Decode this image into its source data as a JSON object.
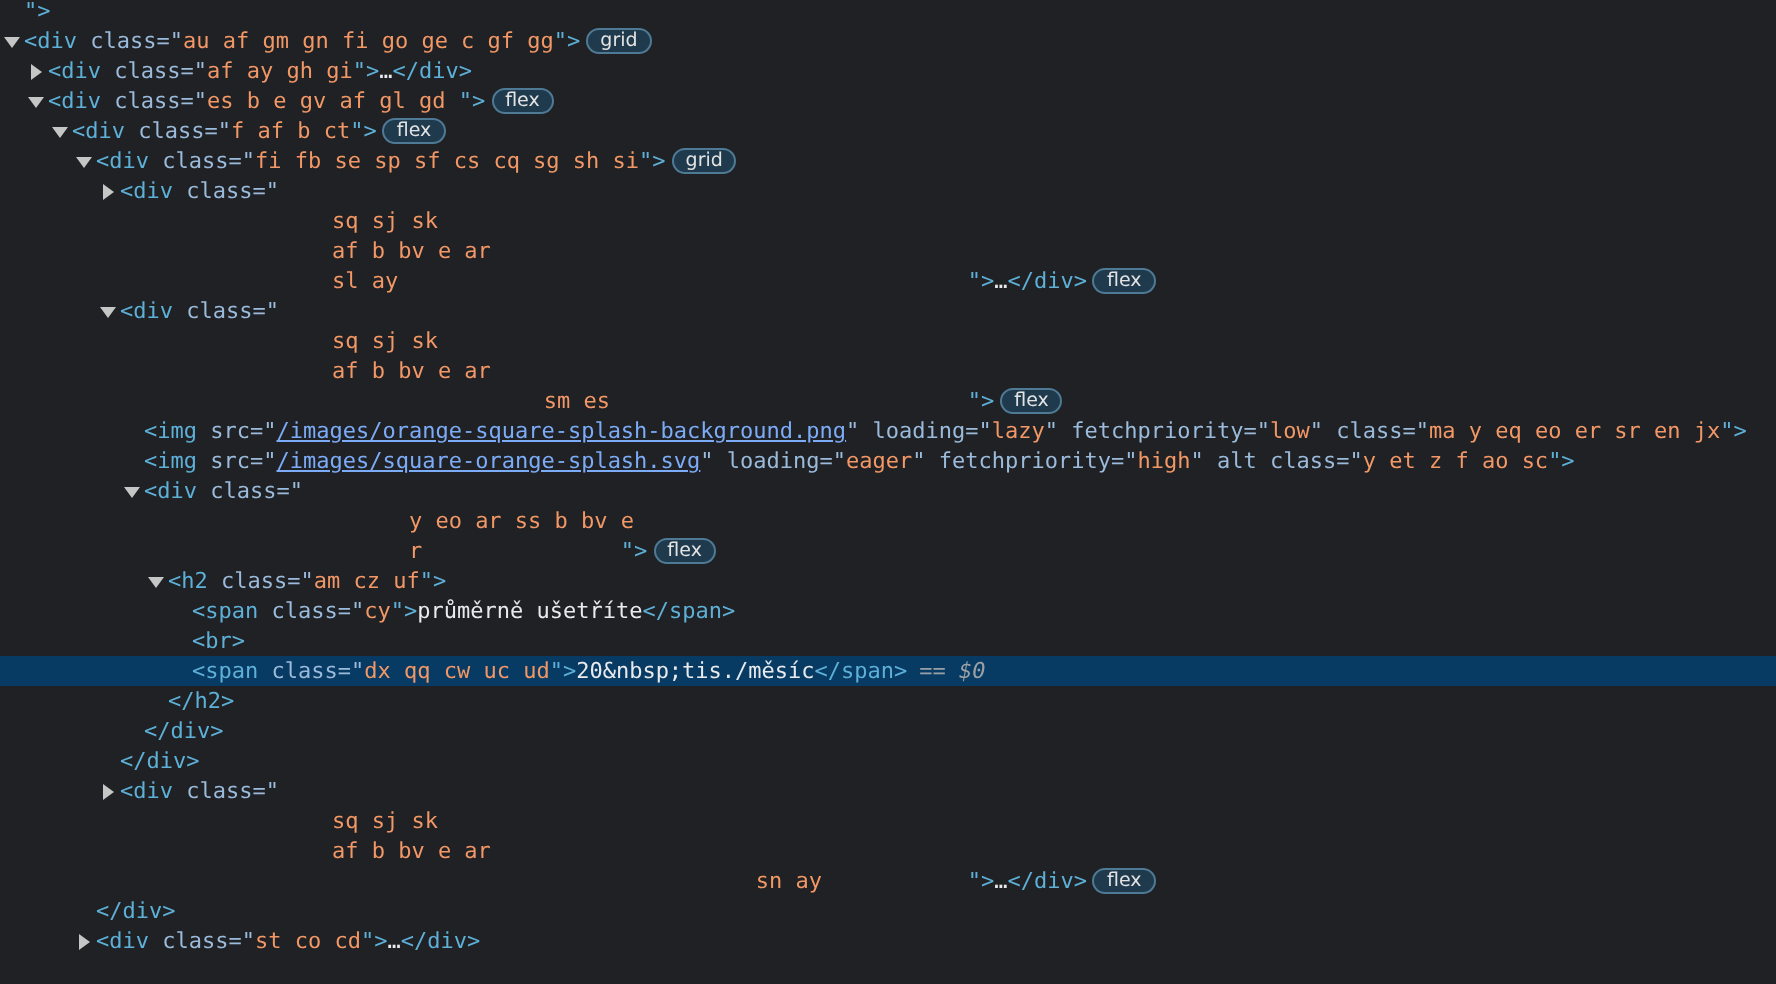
{
  "tree": [
    {
      "kind": "fragment",
      "lines": [
        [
          {
            "text": "\">",
            "kind": "tag"
          }
        ]
      ]
    },
    {
      "kind": "element",
      "expanded": true,
      "selected": false,
      "badge": "grid",
      "lines": [
        [
          {
            "text": "<div",
            "kind": "tag"
          },
          {
            "text": " class=\"",
            "kind": "attr"
          },
          {
            "text": "au af gm gn fi go ge c gf gg",
            "kind": "val"
          },
          {
            "text": "\">",
            "kind": "tag"
          }
        ]
      ],
      "children": [
        {
          "kind": "element",
          "expanded": false,
          "selected": false,
          "lines": [
            [
              {
                "text": "<div",
                "kind": "tag"
              },
              {
                "text": " class=\"",
                "kind": "attr"
              },
              {
                "text": "af ay gh gi",
                "kind": "val"
              },
              {
                "text": "\">",
                "kind": "tag"
              },
              {
                "text": "…",
                "kind": "ell"
              },
              {
                "text": "</div>",
                "kind": "tag"
              }
            ]
          ]
        },
        {
          "kind": "element",
          "expanded": true,
          "selected": false,
          "badge": "flex",
          "lines": [
            [
              {
                "text": "<div",
                "kind": "tag"
              },
              {
                "text": " class=\"",
                "kind": "attr"
              },
              {
                "text": "es b e gv af gl gd ",
                "kind": "val"
              },
              {
                "text": "\">",
                "kind": "tag"
              }
            ]
          ],
          "children": [
            {
              "kind": "element",
              "expanded": true,
              "selected": false,
              "badge": "flex",
              "lines": [
                [
                  {
                    "text": "<div",
                    "kind": "tag"
                  },
                  {
                    "text": " class=\"",
                    "kind": "attr"
                  },
                  {
                    "text": "f af b ct",
                    "kind": "val"
                  },
                  {
                    "text": "\">",
                    "kind": "tag"
                  }
                ]
              ],
              "children": [
                {
                  "kind": "element",
                  "expanded": true,
                  "selected": false,
                  "badge": "grid",
                  "lines": [
                    [
                      {
                        "text": "<div",
                        "kind": "tag"
                      },
                      {
                        "text": " class=\"",
                        "kind": "attr"
                      },
                      {
                        "text": "fi fb se sp sf cs cq sg sh si",
                        "kind": "val"
                      },
                      {
                        "text": "\">",
                        "kind": "tag"
                      }
                    ]
                  ],
                  "close": [
                    {
                      "text": "</div>",
                      "kind": "tag"
                    }
                  ],
                  "children": [
                    {
                      "kind": "element",
                      "expanded": false,
                      "selected": false,
                      "badge": "flex",
                      "lines": [
                        [
                          {
                            "text": "<div",
                            "kind": "tag"
                          },
                          {
                            "text": " class=\"",
                            "kind": "attr"
                          }
                        ],
                        [
                          {
                            "text": "                sq sj sk",
                            "kind": "val"
                          }
                        ],
                        [
                          {
                            "text": "                af b bv e ar",
                            "kind": "val"
                          }
                        ],
                        [
                          {
                            "text": "                sl ay                                           ",
                            "kind": "val"
                          },
                          {
                            "text": "\">",
                            "kind": "tag"
                          },
                          {
                            "text": "…",
                            "kind": "ell"
                          },
                          {
                            "text": "</div>",
                            "kind": "tag"
                          }
                        ]
                      ]
                    },
                    {
                      "kind": "element",
                      "expanded": true,
                      "selected": false,
                      "badge": "flex",
                      "lines": [
                        [
                          {
                            "text": "<div",
                            "kind": "tag"
                          },
                          {
                            "text": " class=\"",
                            "kind": "attr"
                          }
                        ],
                        [
                          {
                            "text": "                sq sj sk",
                            "kind": "val"
                          }
                        ],
                        [
                          {
                            "text": "                af b bv e ar",
                            "kind": "val"
                          }
                        ],
                        [
                          {
                            "text": "                                sm es                           ",
                            "kind": "val"
                          },
                          {
                            "text": "\">",
                            "kind": "tag"
                          }
                        ]
                      ],
                      "close": [
                        {
                          "text": "</div>",
                          "kind": "tag"
                        }
                      ],
                      "children": [
                        {
                          "kind": "element",
                          "selected": false,
                          "lines": [
                            [
                              {
                                "text": "<img",
                                "kind": "tag"
                              },
                              {
                                "text": " src=\"",
                                "kind": "attr"
                              },
                              {
                                "text": "/images/orange-square-splash-background.png",
                                "kind": "link"
                              },
                              {
                                "text": "\" loading=\"",
                                "kind": "attr"
                              },
                              {
                                "text": "lazy",
                                "kind": "val"
                              },
                              {
                                "text": "\" fetchpriority=\"",
                                "kind": "attr"
                              },
                              {
                                "text": "low",
                                "kind": "val"
                              },
                              {
                                "text": "\" class=\"",
                                "kind": "attr"
                              },
                              {
                                "text": "ma y eq eo er sr en jx",
                                "kind": "val"
                              },
                              {
                                "text": "\">",
                                "kind": "tag"
                              }
                            ]
                          ]
                        },
                        {
                          "kind": "element",
                          "selected": false,
                          "lines": [
                            [
                              {
                                "text": "<img",
                                "kind": "tag"
                              },
                              {
                                "text": " src=\"",
                                "kind": "attr"
                              },
                              {
                                "text": "/images/square-orange-splash.svg",
                                "kind": "link"
                              },
                              {
                                "text": "\" loading=\"",
                                "kind": "attr"
                              },
                              {
                                "text": "eager",
                                "kind": "val"
                              },
                              {
                                "text": "\" fetchpriority=\"",
                                "kind": "attr"
                              },
                              {
                                "text": "high",
                                "kind": "val"
                              },
                              {
                                "text": "\" alt class=\"",
                                "kind": "attr"
                              },
                              {
                                "text": "y et z f ao sc",
                                "kind": "val"
                              },
                              {
                                "text": "\">",
                                "kind": "tag"
                              }
                            ]
                          ]
                        },
                        {
                          "kind": "element",
                          "expanded": true,
                          "selected": false,
                          "badge": "flex",
                          "lines": [
                            [
                              {
                                "text": "<div",
                                "kind": "tag"
                              },
                              {
                                "text": " class=\"",
                                "kind": "attr"
                              }
                            ],
                            [
                              {
                                "text": "                    y eo ar ss b bv e",
                                "kind": "val"
                              }
                            ],
                            [
                              {
                                "text": "                    r               ",
                                "kind": "val"
                              },
                              {
                                "text": "\">",
                                "kind": "tag"
                              }
                            ]
                          ],
                          "close": [
                            {
                              "text": "</div>",
                              "kind": "tag"
                            }
                          ],
                          "children": [
                            {
                              "kind": "element",
                              "expanded": true,
                              "selected": false,
                              "lines": [
                                [
                                  {
                                    "text": "<h2",
                                    "kind": "tag"
                                  },
                                  {
                                    "text": " class=\"",
                                    "kind": "attr"
                                  },
                                  {
                                    "text": "am cz uf",
                                    "kind": "val"
                                  },
                                  {
                                    "text": "\">",
                                    "kind": "tag"
                                  }
                                ]
                              ],
                              "close": [
                                {
                                  "text": "</h2>",
                                  "kind": "tag"
                                }
                              ],
                              "children": [
                                {
                                  "kind": "element",
                                  "selected": false,
                                  "lines": [
                                    [
                                      {
                                        "text": "<span",
                                        "kind": "tag"
                                      },
                                      {
                                        "text": " class=\"",
                                        "kind": "attr"
                                      },
                                      {
                                        "text": "cy",
                                        "kind": "val"
                                      },
                                      {
                                        "text": "\">",
                                        "kind": "tag"
                                      },
                                      {
                                        "text": "průměrně ušetříte",
                                        "kind": "text"
                                      },
                                      {
                                        "text": "</span>",
                                        "kind": "tag"
                                      }
                                    ]
                                  ]
                                },
                                {
                                  "kind": "element",
                                  "selected": false,
                                  "lines": [
                                    [
                                      {
                                        "text": "<br>",
                                        "kind": "tag"
                                      }
                                    ]
                                  ]
                                },
                                {
                                  "kind": "element",
                                  "selected": true,
                                  "console_ref": "== $0",
                                  "lines": [
                                    [
                                      {
                                        "text": "<span",
                                        "kind": "tag"
                                      },
                                      {
                                        "text": " class=\"",
                                        "kind": "attr"
                                      },
                                      {
                                        "text": "dx qq cw uc ud",
                                        "kind": "val"
                                      },
                                      {
                                        "text": "\">",
                                        "kind": "tag"
                                      },
                                      {
                                        "text": "20&nbsp;tis./měsíc",
                                        "kind": "text"
                                      },
                                      {
                                        "text": "</span>",
                                        "kind": "tag"
                                      }
                                    ]
                                  ]
                                }
                              ]
                            }
                          ]
                        }
                      ]
                    },
                    {
                      "kind": "element",
                      "expanded": false,
                      "selected": false,
                      "badge": "flex",
                      "lines": [
                        [
                          {
                            "text": "<div",
                            "kind": "tag"
                          },
                          {
                            "text": " class=\"",
                            "kind": "attr"
                          }
                        ],
                        [
                          {
                            "text": "                sq sj sk",
                            "kind": "val"
                          }
                        ],
                        [
                          {
                            "text": "                af b bv e ar",
                            "kind": "val"
                          }
                        ],
                        [
                          {
                            "text": "                                                sn ay           ",
                            "kind": "val"
                          },
                          {
                            "text": "\">",
                            "kind": "tag"
                          },
                          {
                            "text": "…",
                            "kind": "ell"
                          },
                          {
                            "text": "</div>",
                            "kind": "tag"
                          }
                        ]
                      ]
                    }
                  ]
                },
                {
                  "kind": "element",
                  "expanded": false,
                  "selected": false,
                  "lines": [
                    [
                      {
                        "text": "<div",
                        "kind": "tag"
                      },
                      {
                        "text": " class=\"",
                        "kind": "attr"
                      },
                      {
                        "text": "st co cd",
                        "kind": "val"
                      },
                      {
                        "text": "\">",
                        "kind": "tag"
                      },
                      {
                        "text": "…",
                        "kind": "ell"
                      },
                      {
                        "text": "</div>",
                        "kind": "tag"
                      }
                    ]
                  ]
                }
              ]
            }
          ]
        }
      ]
    }
  ]
}
